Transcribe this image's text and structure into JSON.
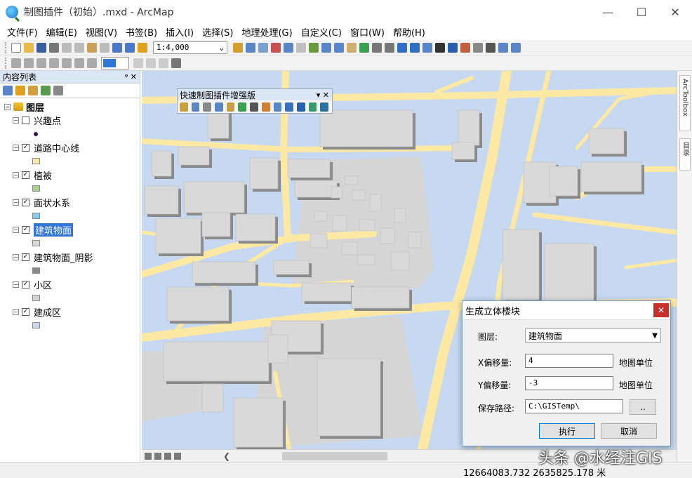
{
  "window": {
    "title": "制图插件（初始）.mxd - ArcMap",
    "minimize": "—",
    "maximize": "☐",
    "close": "✕"
  },
  "menu": [
    "文件(F)",
    "编辑(E)",
    "视图(V)",
    "书签(B)",
    "插入(I)",
    "选择(S)",
    "地理处理(G)",
    "自定义(C)",
    "窗口(W)",
    "帮助(H)"
  ],
  "toolbar": {
    "scale": "1:4,000"
  },
  "toc": {
    "title": "内容列表",
    "pin": "ᵠ ✕",
    "root": "图层",
    "layers": [
      {
        "name": "兴趣点",
        "checked": "",
        "swatch": "#3a1050",
        "dot": true
      },
      {
        "name": "道路中心线",
        "checked": "✓",
        "swatch": "#fde9a4"
      },
      {
        "name": "植被",
        "checked": "✓",
        "swatch": "#a9d18e"
      },
      {
        "name": "面状水系",
        "checked": "✓",
        "swatch": "#7fd0f0"
      },
      {
        "name": "建筑物面",
        "checked": "✓",
        "swatch": "#d9d9d9",
        "selected": true
      },
      {
        "name": "建筑物面_阴影",
        "checked": "✓",
        "swatch": "#8a8a8a"
      },
      {
        "name": "小区",
        "checked": "✓",
        "swatch": "#d5d5d5"
      },
      {
        "name": "建成区",
        "checked": "✓",
        "swatch": "#c6d9f1"
      }
    ]
  },
  "float_toolbar": {
    "title": "快速制图插件增强版",
    "controls": "▾ ✕"
  },
  "dialog": {
    "title": "生成立体楼块",
    "close": "✕",
    "layer_label": "图层:",
    "layer_value": "建筑物面",
    "x_label": "X偏移量:",
    "x_value": "4",
    "x_unit": "地图单位",
    "y_label": "Y偏移量:",
    "y_value": "-3",
    "y_unit": "地图单位",
    "path_label": "保存路径:",
    "path_value": "C:\\GISTemp\\",
    "browse": "..",
    "ok": "执行",
    "cancel": "取消"
  },
  "dock": {
    "tab1": "ArcToolbox",
    "tab2": "目录"
  },
  "status": {
    "coords": "12664083.732  2635825.178 米"
  },
  "watermark": "头条 @水经注GIS",
  "colors": {
    "background_area": "#c6d9f1",
    "road": "#fde9a4",
    "building": "#d9d9d9",
    "shadow": "#8a8a8a",
    "community": "#d5d5d5",
    "selection": "#3375d6"
  }
}
